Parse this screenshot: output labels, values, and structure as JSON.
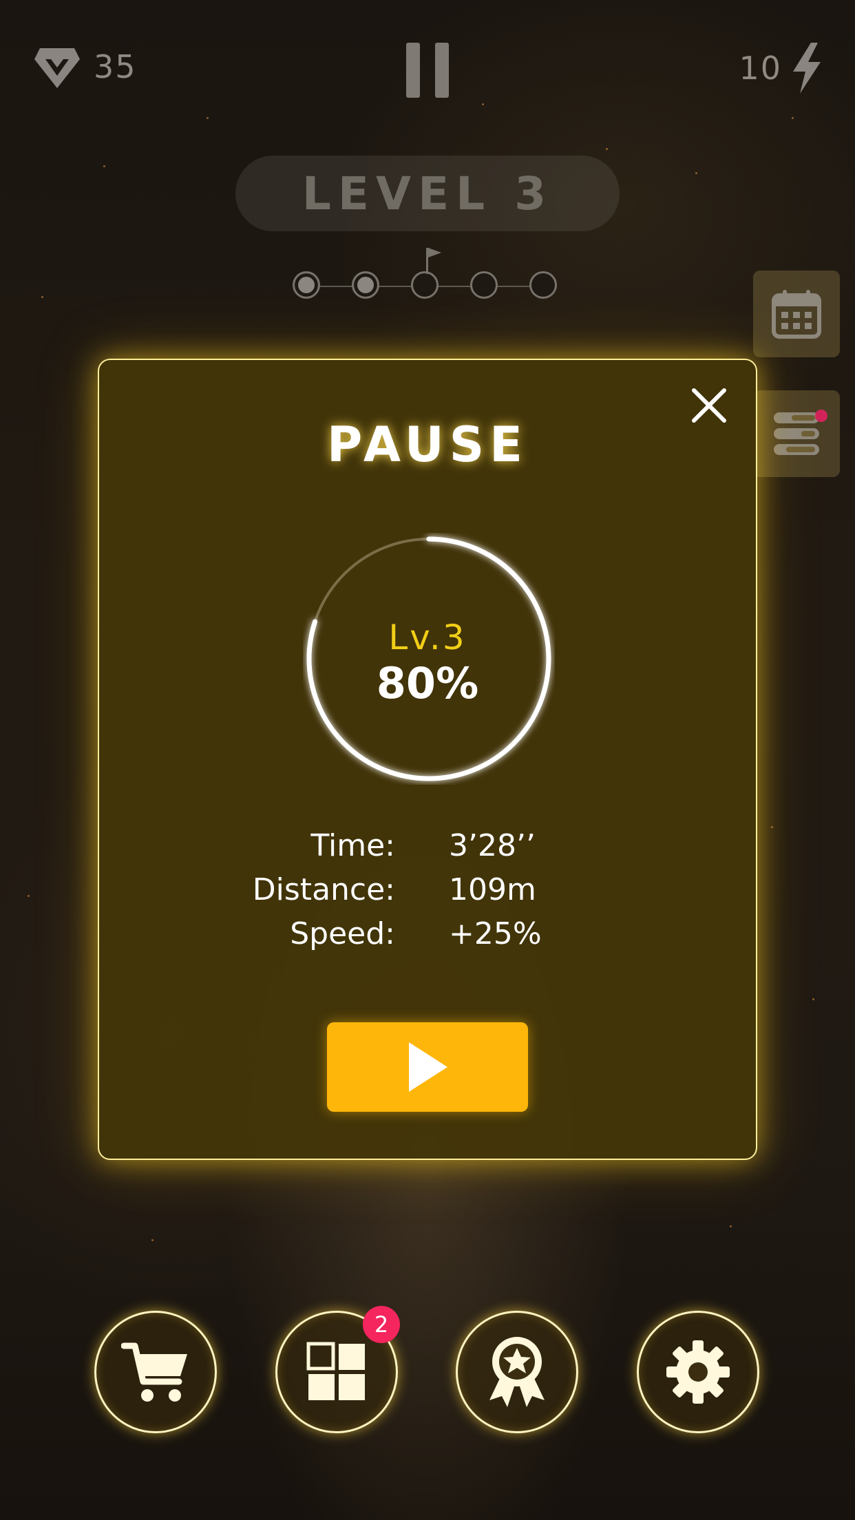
{
  "hud": {
    "gems": "35",
    "energy": "10",
    "level_title": "LEVEL 3",
    "stage_progress": {
      "total": 5,
      "completed": 2,
      "flag_at": 3
    }
  },
  "pause_modal": {
    "title": "PAUSE",
    "level_label": "Lv.3",
    "percent_label": "80%",
    "progress": 0.8,
    "stats": [
      {
        "label": "Time:",
        "value": "3’28’’"
      },
      {
        "label": "Distance:",
        "value": "109m"
      },
      {
        "label": "Speed:",
        "value": "+25%"
      }
    ]
  },
  "bottom_nav": {
    "items": [
      {
        "name": "shop",
        "icon": "cart-icon"
      },
      {
        "name": "collection",
        "icon": "grid-icon",
        "badge": "2"
      },
      {
        "name": "achievements",
        "icon": "ribbon-star-icon"
      },
      {
        "name": "settings",
        "icon": "gear-icon"
      }
    ]
  },
  "colors": {
    "accent": "#ffb60a",
    "level_text": "#f2cf17",
    "badge": "#f5255e",
    "modal_border": "#ffef9a"
  }
}
